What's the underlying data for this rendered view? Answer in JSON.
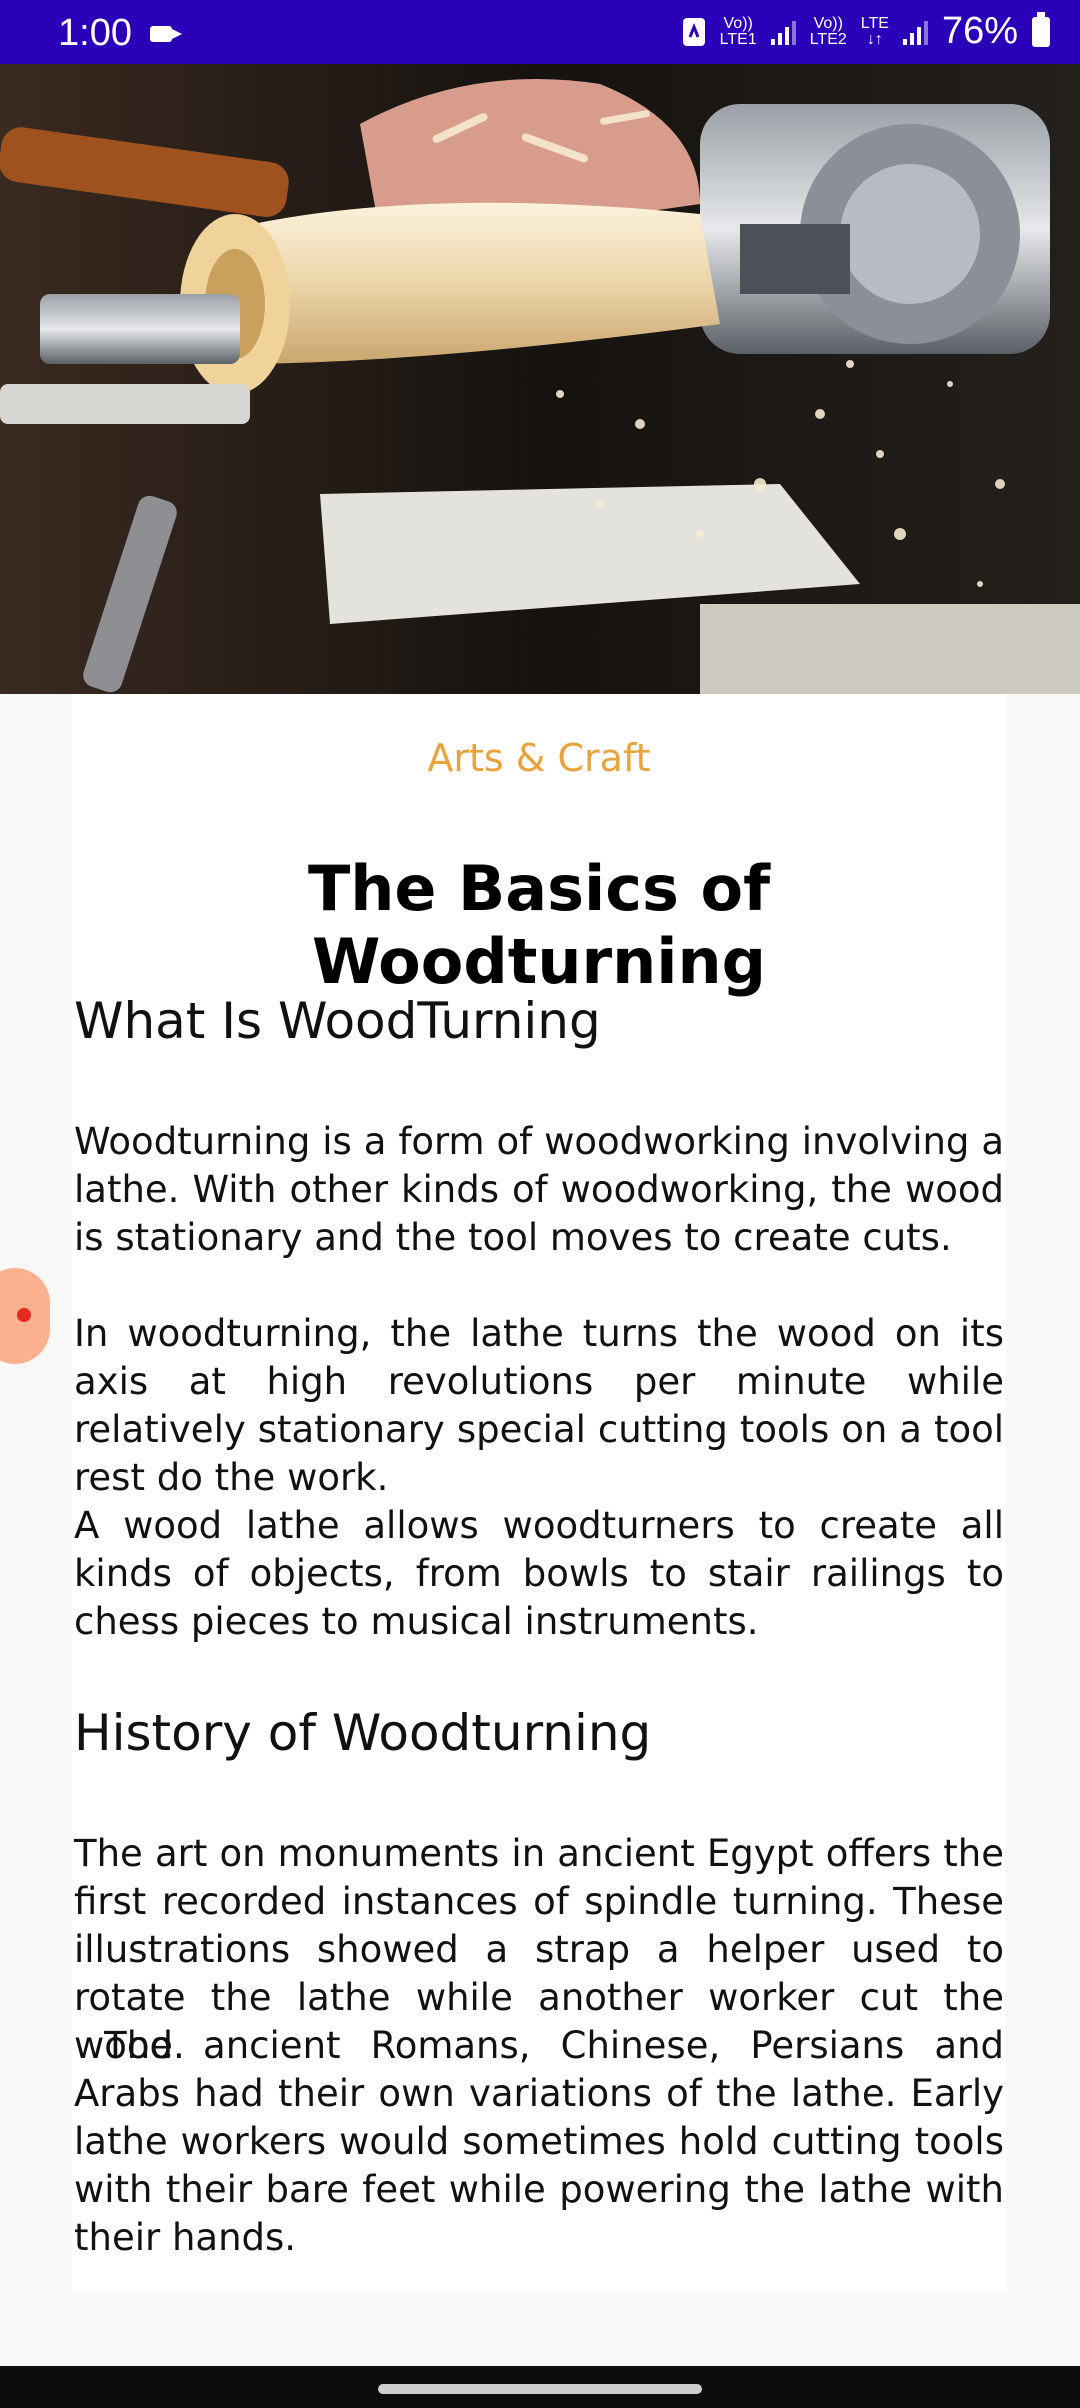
{
  "status_bar": {
    "time": "1:00",
    "sim1_line1": "Vo))",
    "sim1_line2": "LTE1",
    "sim2_line1": "Vo))",
    "sim2_line2": "LTE2",
    "network": "LTE",
    "battery": "76%"
  },
  "hero": {
    "image_subject": "wood lathe turning a piece of wood with shavings flying"
  },
  "article": {
    "category": "Arts & Craft",
    "title": "The Basics of Woodturning",
    "section1_heading": "What Is WoodTurning",
    "para1": "Woodturning is a form of woodworking involving a lathe. With other kinds of woodworking, the wood is stationary and the tool moves to create cuts.",
    "para2": "In woodturning, the lathe turns the wood on its axis at high revolutions per minute while relatively stationary special cutting tools on a tool rest do the work.",
    "para3": "A wood lathe allows woodturners to create all kinds of objects, from bowls to stair railings to chess pieces to musical instruments.",
    "section2_heading": "History of Woodturning",
    "para4": "The art on monuments in ancient Egypt offers the first recorded instances of spindle turning. These illustrations showed a strap a helper used to rotate the lathe while another worker cut the wood.",
    "para5": " The ancient Romans, Chinese, Persians and Arabs had their own variations of the lathe. Early lathe workers would sometimes hold cutting tools with their bare feet while powering the lathe with their hands."
  },
  "colors": {
    "status_bar": "#2a00b8",
    "category": "#e9a33a",
    "background": "#f8f8f8",
    "card": "#ffffff",
    "floating_button": "#fbb08f"
  }
}
